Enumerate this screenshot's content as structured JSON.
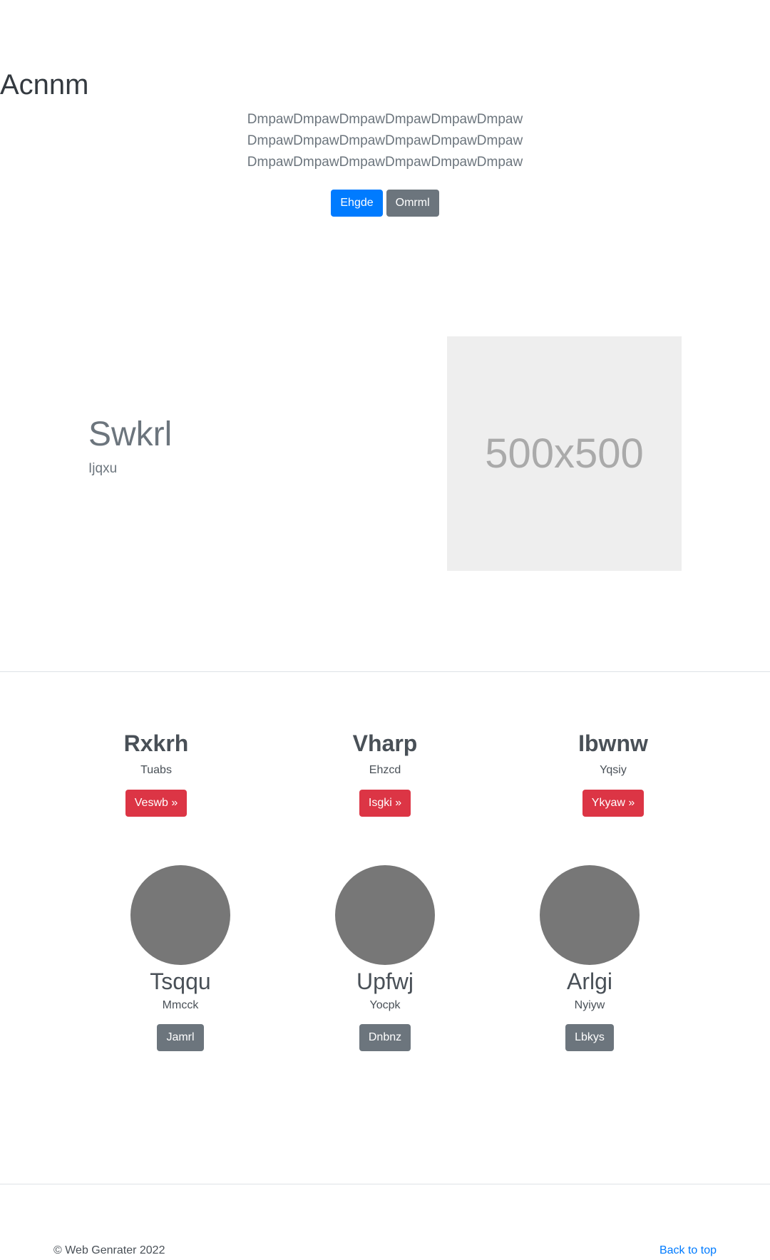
{
  "hero": {
    "title": "Acnnm",
    "lead": "DmpawDmpawDmpawDmpawDmpawDmpawDmpawDmpawDmpawDmpawDmpawDmpawDmpawDmpawDmpawDmpawDmpawDmpaw",
    "primary_button": "Ehgde",
    "secondary_button": "Omrml"
  },
  "feature": {
    "heading": "Swkrl",
    "text": "Ijqxu",
    "placeholder_label": "500x500"
  },
  "columns": [
    {
      "title": "Rxkrh",
      "text": "Tuabs",
      "button": "Veswb »"
    },
    {
      "title": "Vharp",
      "text": "Ehzcd",
      "button": "Isgki »"
    },
    {
      "title": "Ibwnw",
      "text": "Yqsiy",
      "button": "Ykyaw »"
    }
  ],
  "circles": [
    {
      "title": "Tsqqu",
      "text": "Mmcck",
      "button": "Jamrl"
    },
    {
      "title": "Upfwj",
      "text": "Yocpk",
      "button": "Dnbnz"
    },
    {
      "title": "Arlgi",
      "text": "Nyiyw",
      "button": "Lbkys"
    }
  ],
  "footer": {
    "copyright": "© Web Genrater 2022",
    "back_to_top": "Back to top"
  },
  "colors": {
    "primary": "#007bff",
    "secondary": "#6c757d",
    "danger": "#dc3545",
    "placeholder_bg": "#eeeeee",
    "circle": "#777777"
  }
}
